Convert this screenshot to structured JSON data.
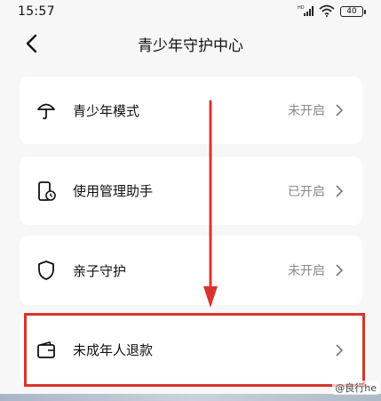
{
  "status_bar": {
    "time": "15:57",
    "battery": "40"
  },
  "header": {
    "title": "青少年守护中心"
  },
  "menu": [
    {
      "label": "青少年模式",
      "status": "未开启",
      "icon": "umbrella-icon"
    },
    {
      "label": "使用管理助手",
      "status": "已开启",
      "icon": "phone-clock-icon"
    },
    {
      "label": "亲子守护",
      "status": "未开启",
      "icon": "shield-icon"
    },
    {
      "label": "未成年人退款",
      "status": "",
      "icon": "wallet-icon"
    }
  ],
  "annotation": {
    "highlight_color": "#d9342b",
    "arrow_color": "#d9342b"
  },
  "watermark": {
    "text": "@良行he"
  }
}
